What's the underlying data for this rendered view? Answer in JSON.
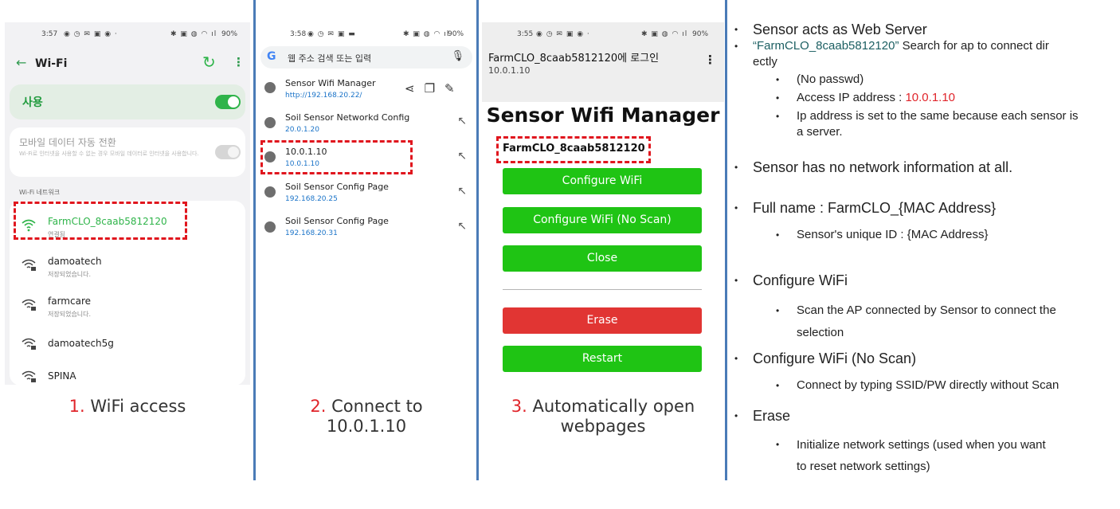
{
  "panel1": {
    "status": {
      "time": "3:57",
      "battery": "90%"
    },
    "title": "Wi-Fi",
    "use_label": "사용",
    "mobile_switch_title": "모바일 데이터 자동 전환",
    "mobile_switch_desc": "Wi-Fi로 인터넷을 사용할 수 없는 경우 모바일 데이터로 인터넷을 사용합니다.",
    "section_label": "Wi-Fi 네트워크",
    "networks": [
      {
        "name": "FarmCLO_8caab5812120",
        "status": "연결됨"
      },
      {
        "name": "damoatech",
        "status": "저장되었습니다."
      },
      {
        "name": "farmcare",
        "status": "저장되었습니다."
      },
      {
        "name": "damoatech5g",
        "status": ""
      },
      {
        "name": "SPINA",
        "status": ""
      }
    ],
    "caption_num": "1.",
    "caption_text": "WiFi access"
  },
  "panel2": {
    "status": {
      "time": "3:58",
      "battery": "90%"
    },
    "search_placeholder": "웹 주소 검색 또는 입력",
    "suggestions": [
      {
        "title": "Sensor Wifi Manager",
        "url": "http://192.168.20.22/"
      },
      {
        "title": "Soil Sensor Networkd Config",
        "url": "20.0.1.20"
      },
      {
        "title": "10.0.1.10",
        "url": "10.0.1.10"
      },
      {
        "title": "Soil Sensor Config Page",
        "url": "192.168.20.25"
      },
      {
        "title": "Soil Sensor Config Page",
        "url": "192.168.20.31"
      }
    ],
    "caption_num": "2.",
    "caption_line1": "Connect to",
    "caption_line2": "10.0.1.10"
  },
  "panel3": {
    "status": {
      "time": "3:55",
      "battery": "90%"
    },
    "page_title": "FarmCLO_8caab5812120에 로그인",
    "page_ip": "10.0.1.10",
    "heading": "Sensor Wifi Manager",
    "ap_name": "FarmCLO_8caab5812120",
    "buttons": {
      "configure": "Configure WiFi",
      "configure_noscan": "Configure WiFi (No Scan)",
      "close": "Close",
      "erase": "Erase",
      "restart": "Restart"
    },
    "colors": {
      "green": "#1fc414",
      "red": "#e13533"
    },
    "caption_num": "3.",
    "caption_line1": "Automatically open",
    "caption_line2": "webpages"
  },
  "notes": {
    "n1": "Sensor acts as Web Server",
    "n2_quote": "“FarmCLO_8caab5812120”",
    "n2_rest": " Search for ap to connect dir",
    "n2_cont": "ectly",
    "n2a": "(No passwd)",
    "n2b_label": "Access IP address : ",
    "n2b_value": "10.0.1.10",
    "n2c_line1": "Ip address is set to the same because each sensor is",
    "n2c_line2": "a server.",
    "n3": "Sensor has no network information at all.",
    "n4": "Full name : FarmCLO_{MAC Address}",
    "n4a": "Sensor's unique ID : {MAC Address}",
    "n5": "Configure WiFi",
    "n5a_line1": "Scan the AP connected by Sensor to connect the",
    "n5a_line2": "selection",
    "n6": "Configure WiFi (No Scan)",
    "n6a": "Connect by typing SSID/PW directly without Scan",
    "n7": "Erase",
    "n7a_line1": "Initialize network settings (used when you want",
    "n7a_line2": "to reset network settings)"
  }
}
